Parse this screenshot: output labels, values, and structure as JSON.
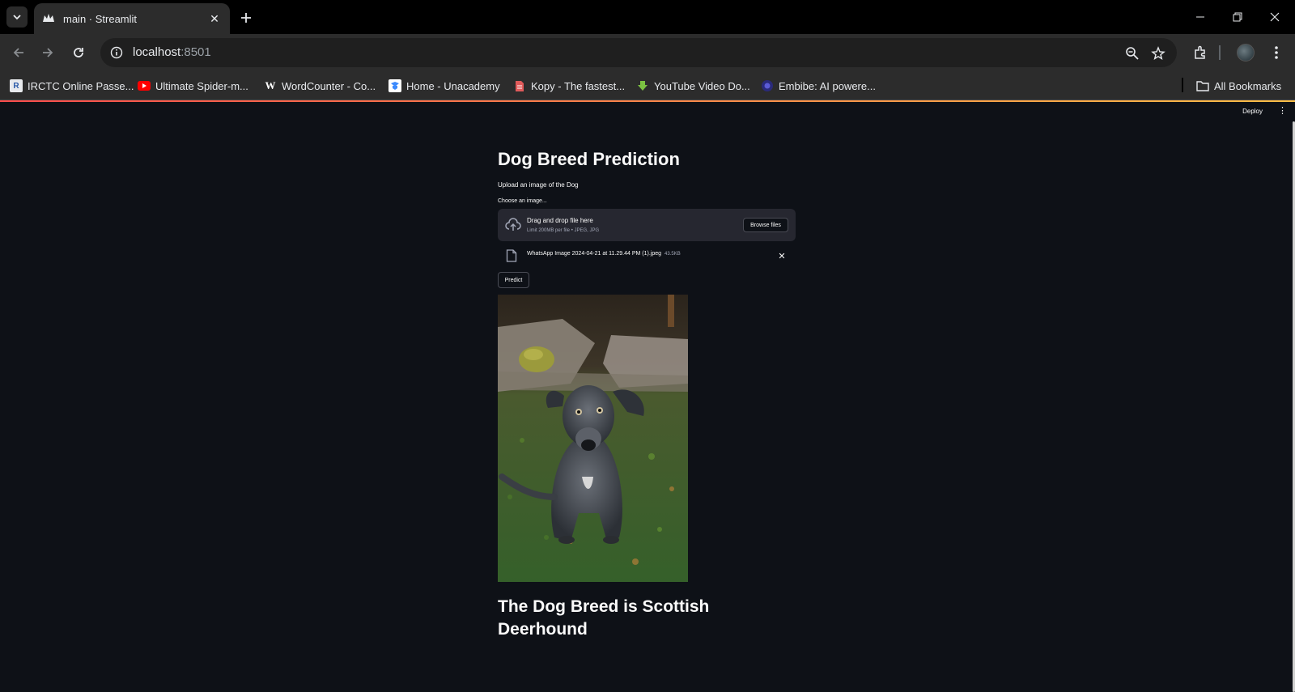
{
  "browser": {
    "tab": {
      "title": "main · Streamlit"
    },
    "address": {
      "host": "localhost",
      "port": ":8501"
    },
    "bookmarks": [
      {
        "label": "IRCTC Online Passe...",
        "icon": "irctc-icon",
        "color": "#2a5aa8"
      },
      {
        "label": "Ultimate Spider-m...",
        "icon": "youtube-icon",
        "color": "#ff0000"
      },
      {
        "label": "WordCounter - Co...",
        "icon": "w-icon",
        "color": "#ffffff"
      },
      {
        "label": "Home - Unacademy",
        "icon": "unacademy-icon",
        "color": "#3d8bfd"
      },
      {
        "label": "Kopy - The fastest...",
        "icon": "document-icon",
        "color": "#e05a5a"
      },
      {
        "label": "YouTube Video Do...",
        "icon": "download-arrow-icon",
        "color": "#7cc242"
      },
      {
        "label": "Embibe: AI powere...",
        "icon": "embibe-icon",
        "color": "#3b3bb3"
      }
    ],
    "all_bookmarks": "All Bookmarks"
  },
  "app": {
    "deploy": "Deploy",
    "title": "Dog Breed Prediction",
    "subtitle": "Upload an image of the Dog",
    "uploader": {
      "label": "Choose an image...",
      "drop_text": "Drag and drop file here",
      "limit_text": "Limit 200MB per file • JPEG, JPG",
      "browse_label": "Browse files"
    },
    "file": {
      "name": "WhatsApp Image 2024-04-21 at 11.29.44 PM (1).jpeg",
      "size": "43.5KB"
    },
    "predict_label": "Predict",
    "result": "The Dog Breed is Scottish Deerhound"
  },
  "colors": {
    "app_bg": "#0e1117",
    "accent_start": "#ff4b4b",
    "accent_end": "#ffbd45"
  }
}
